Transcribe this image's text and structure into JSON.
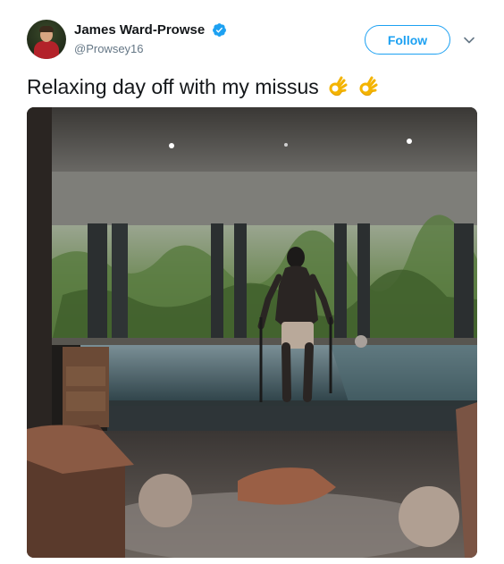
{
  "tweet": {
    "author": {
      "display_name": "James Ward-Prowse",
      "handle": "@Prowsey16",
      "verified": true
    },
    "follow_label": "Follow",
    "text": "Relaxing day off with my missus",
    "emoji": [
      "ok-hand-emoji",
      "ok-hand-emoji"
    ],
    "media": {
      "kind": "photo",
      "subject": "man standing by indoor spa pool"
    }
  },
  "colors": {
    "accent": "#1da1f2",
    "text": "#14171a",
    "secondary_text": "#657786"
  }
}
